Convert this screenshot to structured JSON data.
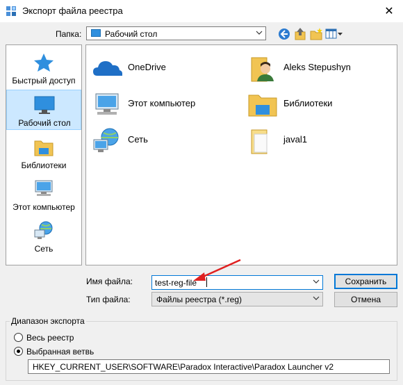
{
  "window": {
    "title": "Экспорт файла реестра",
    "close_glyph": "✕"
  },
  "folder_row": {
    "label": "Папка:",
    "current": "Рабочий стол"
  },
  "toolbar": {
    "icons": [
      "back-icon",
      "up-folder-icon",
      "new-folder-icon",
      "view-menu-icon"
    ]
  },
  "places": [
    {
      "label": "Быстрый доступ",
      "icon": "star-icon"
    },
    {
      "label": "Рабочий стол",
      "icon": "desktop-icon",
      "selected": true
    },
    {
      "label": "Библиотеки",
      "icon": "libraries-icon"
    },
    {
      "label": "Этот компьютер",
      "icon": "computer-icon"
    },
    {
      "label": "Сеть",
      "icon": "network-icon"
    }
  ],
  "files": [
    {
      "label": "OneDrive",
      "icon": "onedrive-icon"
    },
    {
      "label": "Aleks Stepushyn",
      "icon": "user-folder-icon"
    },
    {
      "label": "Этот компьютер",
      "icon": "computer-icon"
    },
    {
      "label": "Библиотеки",
      "icon": "libraries-icon"
    },
    {
      "label": "Сеть",
      "icon": "network-icon"
    },
    {
      "label": "javal1",
      "icon": "folder-icon"
    }
  ],
  "filename": {
    "label": "Имя файла:",
    "value": "test-reg-file"
  },
  "filetype": {
    "label": "Тип файла:",
    "value": "Файлы реестра (*.reg)"
  },
  "buttons": {
    "save": "Сохранить",
    "cancel": "Отмена"
  },
  "export_range": {
    "legend": "Диапазон экспорта",
    "option_all": "Весь реестр",
    "option_branch": "Выбранная ветвь",
    "selected": "option_branch",
    "branch_path": "HKEY_CURRENT_USER\\SOFTWARE\\Paradox Interactive\\Paradox Launcher v2"
  },
  "colors": {
    "accent": "#0078d7",
    "selection": "#cce8ff",
    "annotation_arrow": "#e02020"
  }
}
